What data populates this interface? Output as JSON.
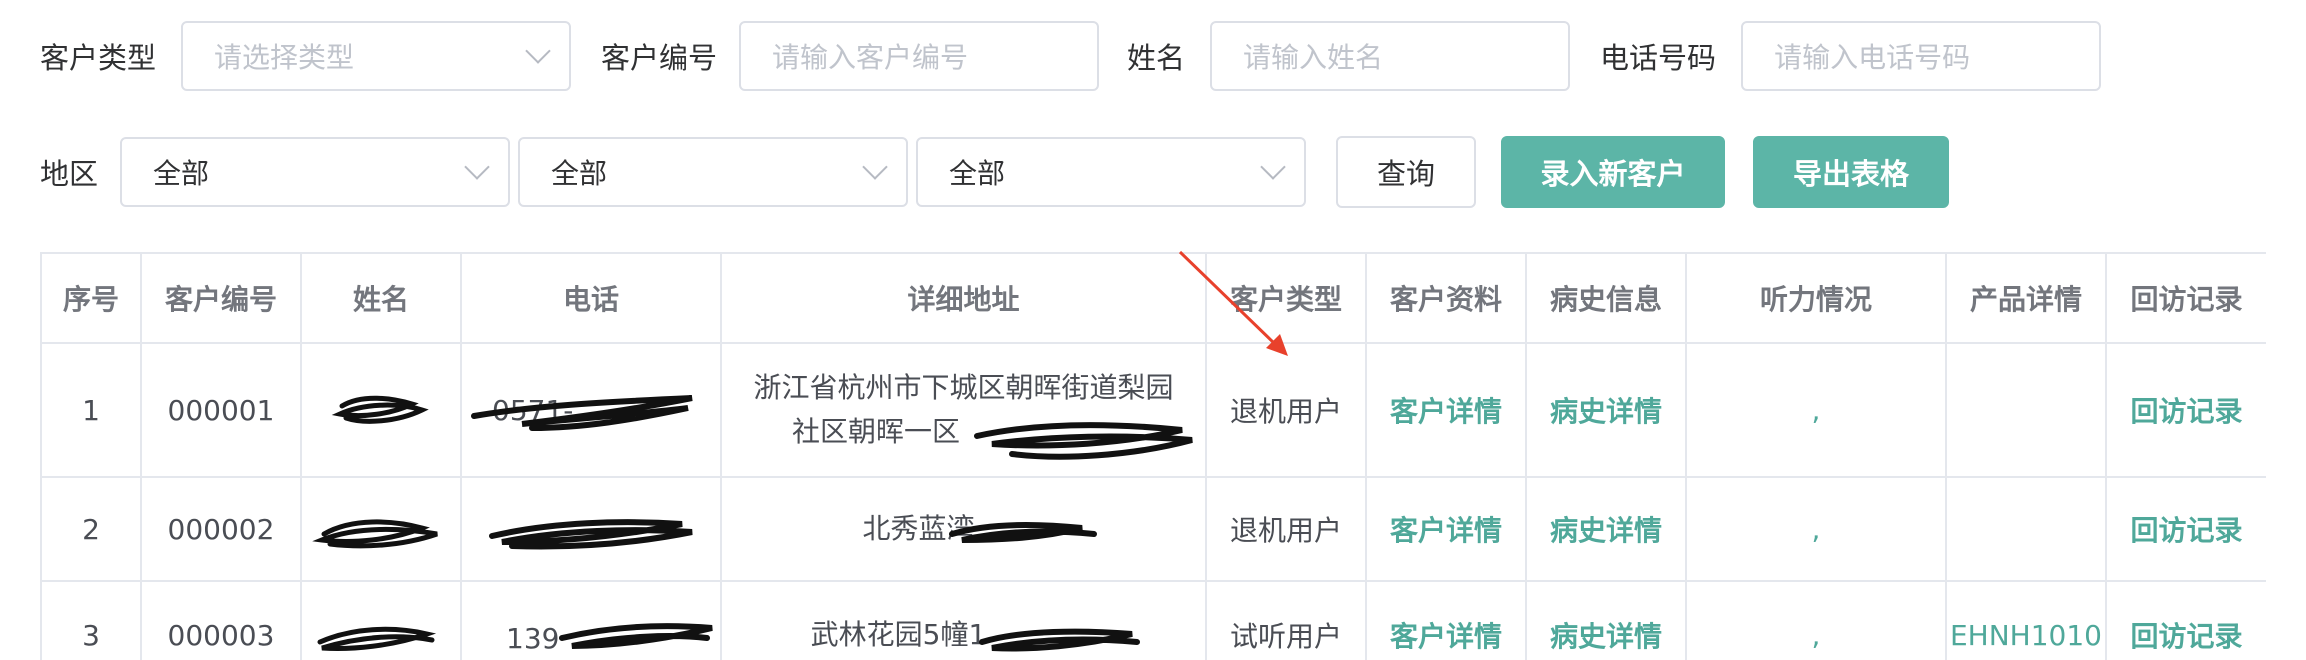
{
  "filters": {
    "customer_type": {
      "label": "客户类型",
      "placeholder": "请选择类型"
    },
    "customer_no": {
      "label": "客户编号",
      "placeholder": "请输入客户编号"
    },
    "name": {
      "label": "姓名",
      "placeholder": "请输入姓名"
    },
    "phone": {
      "label": "电话号码",
      "placeholder": "请输入电话号码"
    },
    "region": {
      "label": "地区",
      "selects": [
        "全部",
        "全部",
        "全部"
      ]
    }
  },
  "buttons": {
    "search": "查询",
    "add_customer": "录入新客户",
    "export": "导出表格"
  },
  "table": {
    "headers": [
      "序号",
      "客户编号",
      "姓名",
      "电话",
      "详细地址",
      "客户类型",
      "客户资料",
      "病史信息",
      "听力情况",
      "产品详情",
      "回访记录"
    ],
    "rows": [
      {
        "index": "1",
        "customer_no": "000001",
        "name": "",
        "phone": "0571-",
        "address_line1": "浙江省杭州市下城区朝晖街道梨园",
        "address_line2": "社区朝晖一区",
        "type": "退机用户",
        "profile": "客户详情",
        "history": "病史详情",
        "hearing": ",",
        "product": "",
        "visit": "回访记录"
      },
      {
        "index": "2",
        "customer_no": "000002",
        "name": "",
        "phone": "",
        "address_line1": "北秀蓝湾",
        "address_line2": "",
        "type": "退机用户",
        "profile": "客户详情",
        "history": "病史详情",
        "hearing": ",",
        "product": "",
        "visit": "回访记录"
      },
      {
        "index": "3",
        "customer_no": "000003",
        "name": "",
        "phone": "139",
        "address_line1": "武林花园5幢1",
        "address_line2": "",
        "type": "试听用户",
        "profile": "客户详情",
        "history": "病史详情",
        "hearing": ",",
        "product": "EHNH1010",
        "visit": "回访记录"
      }
    ]
  },
  "colors": {
    "accent": "#5cb5a7",
    "link": "#4fa89a",
    "annotation_arrow": "#e8412c"
  },
  "icons": {
    "select_arrow": "chevron-down-icon",
    "annotation": "red-arrow-icon"
  }
}
